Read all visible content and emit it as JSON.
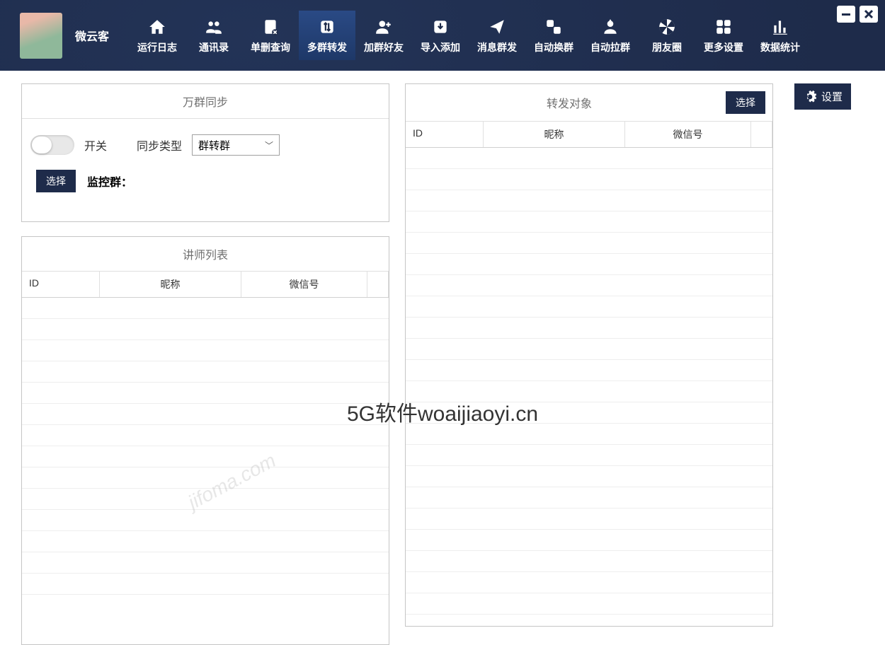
{
  "brand": "微云客",
  "nav": [
    {
      "label": "运行日志"
    },
    {
      "label": "通讯录"
    },
    {
      "label": "单删查询"
    },
    {
      "label": "多群转发"
    },
    {
      "label": "加群好友"
    },
    {
      "label": "导入添加"
    },
    {
      "label": "消息群发"
    },
    {
      "label": "自动换群"
    },
    {
      "label": "自动拉群"
    },
    {
      "label": "朋友圈"
    },
    {
      "label": "更多设置"
    },
    {
      "label": "数据统计"
    }
  ],
  "panel_settings_title": "万群同步",
  "switch_label": "开关",
  "sync_type_label": "同步类型",
  "sync_type_value": "群转群",
  "select_button": "选择",
  "monitor_label": "监控群：",
  "panel_list_title": "讲师列表",
  "columns": {
    "id": "ID",
    "nick": "昵称",
    "wx": "微信号"
  },
  "panel_target_title": "转发对象",
  "side_settings": "设置",
  "watermark": "5G软件woaijiaoyi.cn",
  "watermark2": "jifoma.com"
}
